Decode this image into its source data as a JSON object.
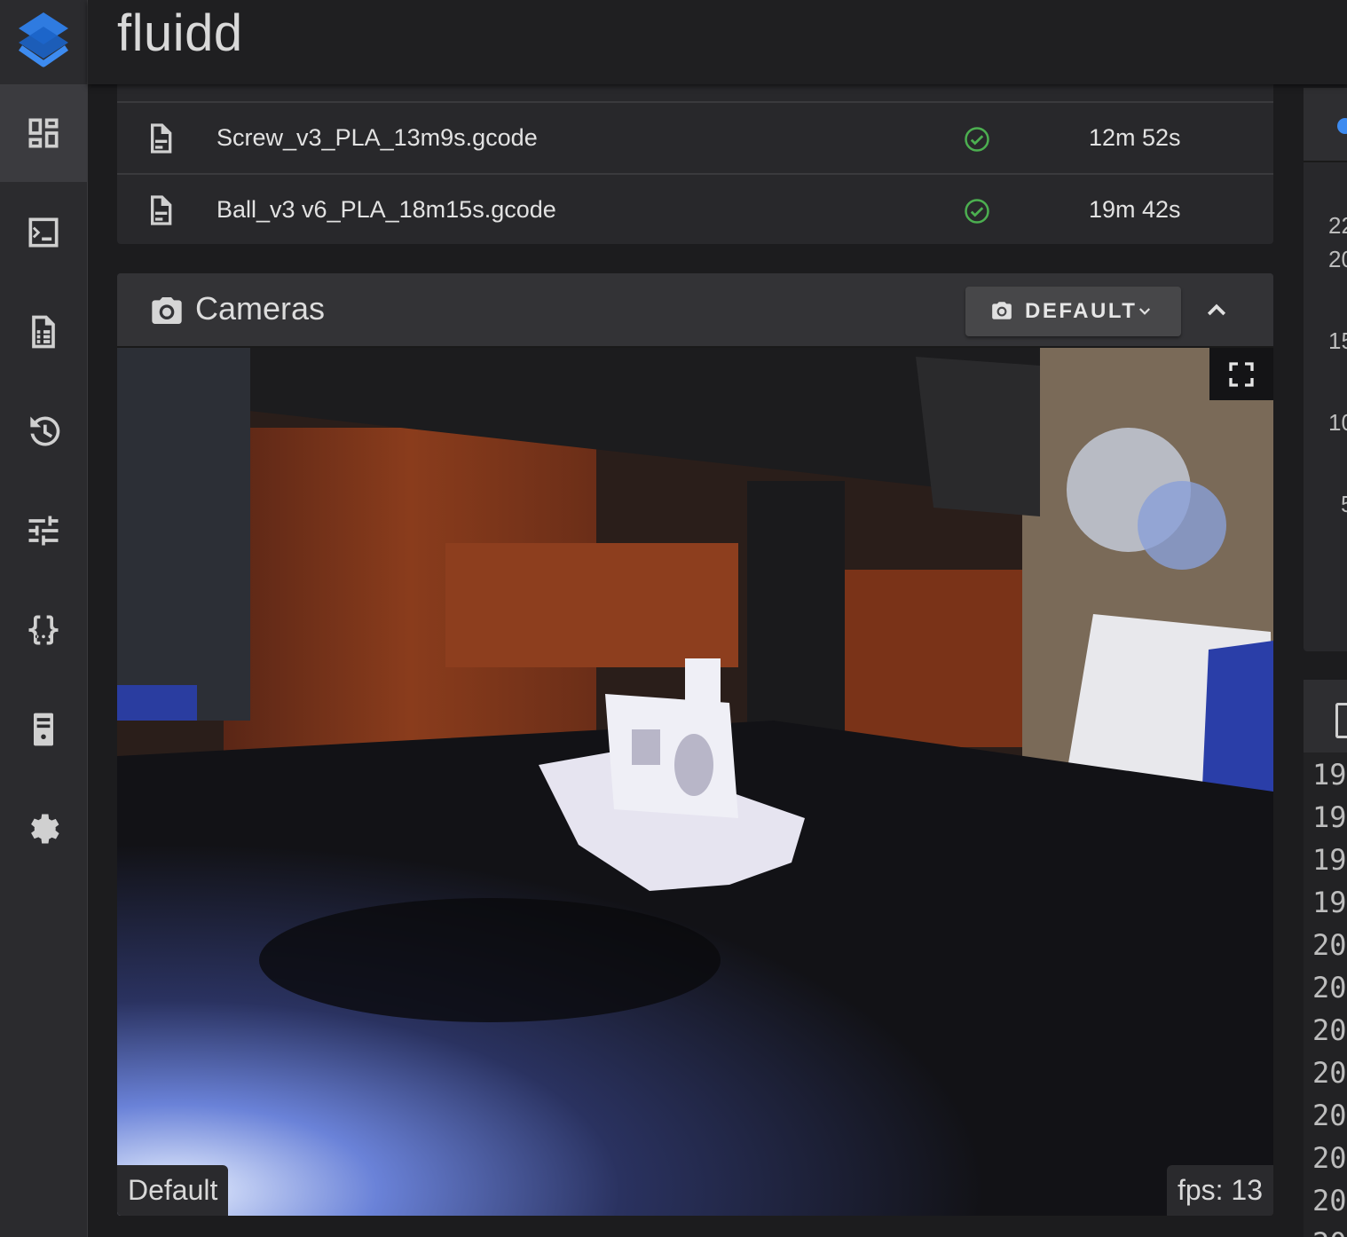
{
  "app": {
    "title": "fluidd"
  },
  "nav": [
    {
      "name": "dashboard",
      "icon": "dashboard-icon",
      "active": true
    },
    {
      "name": "console",
      "icon": "console-icon"
    },
    {
      "name": "jobs",
      "icon": "file-document-icon"
    },
    {
      "name": "history",
      "icon": "history-icon"
    },
    {
      "name": "tune",
      "icon": "tune-icon"
    },
    {
      "name": "configuration",
      "icon": "code-braces-icon"
    },
    {
      "name": "system",
      "icon": "server-icon"
    },
    {
      "name": "settings",
      "icon": "gear-icon"
    }
  ],
  "jobs": {
    "rows": [
      {
        "file": "Screw_v3_PLA_13m9s.gcode",
        "status": "completed",
        "duration": "12m 52s"
      },
      {
        "file": "Ball_v3 v6_PLA_18m15s.gcode",
        "status": "completed",
        "duration": "19m 42s"
      }
    ]
  },
  "cameras": {
    "title": "Cameras",
    "selected": "DEFAULT",
    "camera_name": "Default",
    "fps": "fps: 13"
  },
  "right_panel": {
    "chart_ticks": [
      "22",
      "20",
      "15",
      "10",
      "5"
    ],
    "console_lines": [
      "19",
      "19",
      "19",
      "19",
      "20",
      "20",
      "20",
      "20",
      "20",
      "20",
      "20",
      "20"
    ]
  },
  "colors": {
    "success": "#4caf50",
    "accent": "#2196f3",
    "sidebar_bg": "#2b2b2e"
  }
}
